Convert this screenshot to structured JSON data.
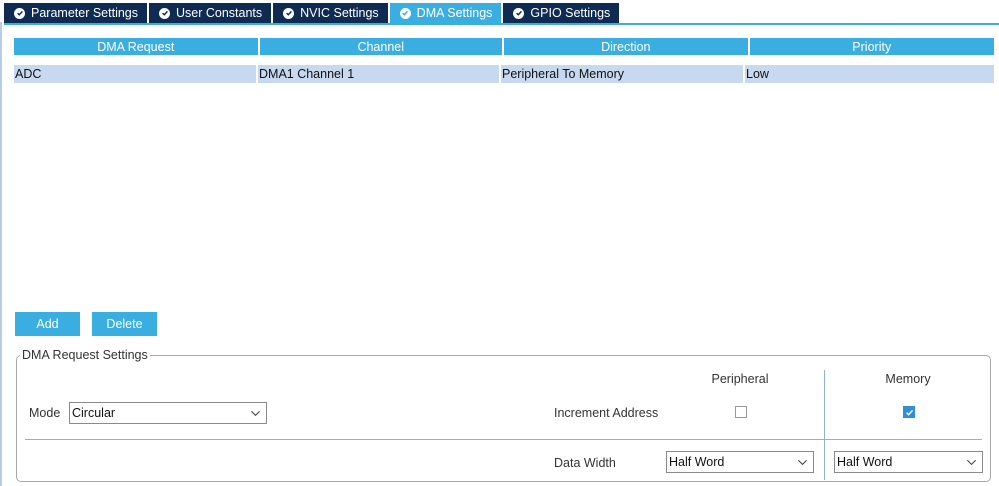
{
  "tabs": [
    {
      "label": "Parameter Settings",
      "active": false
    },
    {
      "label": "User Constants",
      "active": false
    },
    {
      "label": "NVIC Settings",
      "active": false
    },
    {
      "label": "DMA Settings",
      "active": true
    },
    {
      "label": "GPIO Settings",
      "active": false
    }
  ],
  "table": {
    "headers": [
      "DMA Request",
      "Channel",
      "Direction",
      "Priority"
    ],
    "rows": [
      [
        "ADC",
        "DMA1 Channel 1",
        "Peripheral To Memory",
        "Low"
      ]
    ]
  },
  "buttons": {
    "add": "Add",
    "delete": "Delete"
  },
  "settings": {
    "legend": "DMA Request Settings",
    "mode_label": "Mode",
    "mode_value": "Circular",
    "peripheral_header": "Peripheral",
    "memory_header": "Memory",
    "increment_label": "Increment Address",
    "peripheral_increment": false,
    "memory_increment": true,
    "data_width_label": "Data Width",
    "peripheral_width": "Half Word",
    "memory_width": "Half Word"
  },
  "colors": {
    "accent": "#3aaee0",
    "tab_bg": "#0f2b52",
    "row_selected": "#c6d9ee"
  }
}
